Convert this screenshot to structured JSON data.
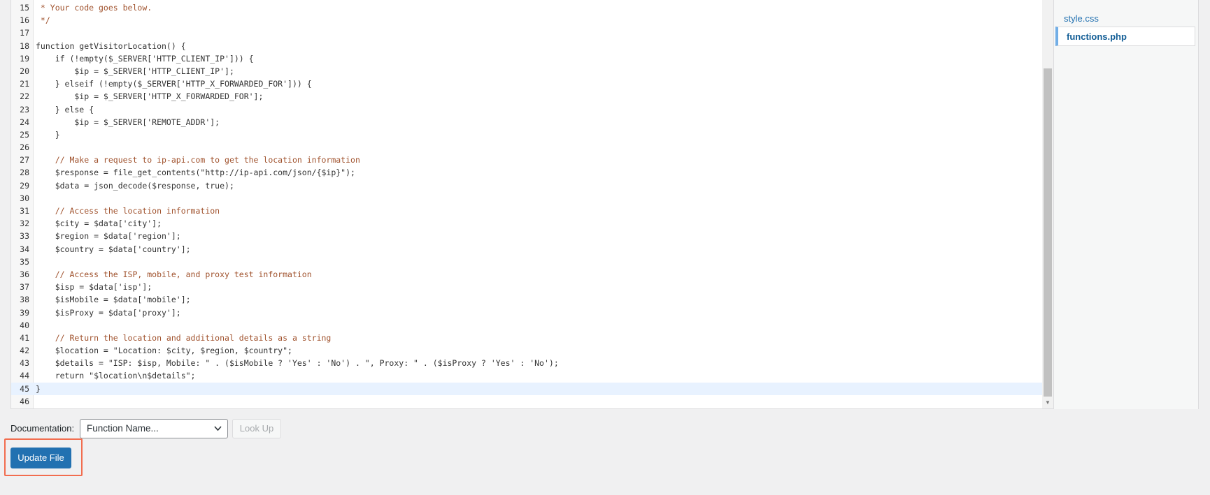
{
  "editor": {
    "lines": [
      {
        "n": "15",
        "t": " * Your code goes below.",
        "k": "com"
      },
      {
        "n": "16",
        "t": " */",
        "k": "com"
      },
      {
        "n": "17",
        "t": "",
        "k": ""
      },
      {
        "n": "18",
        "t": "function getVisitorLocation() {",
        "k": "fn"
      },
      {
        "n": "19",
        "t": "    if (!empty($_SERVER['HTTP_CLIENT_IP'])) {",
        "k": "code"
      },
      {
        "n": "20",
        "t": "        $ip = $_SERVER['HTTP_CLIENT_IP'];",
        "k": "code"
      },
      {
        "n": "21",
        "t": "    } elseif (!empty($_SERVER['HTTP_X_FORWARDED_FOR'])) {",
        "k": "code"
      },
      {
        "n": "22",
        "t": "        $ip = $_SERVER['HTTP_X_FORWARDED_FOR'];",
        "k": "code"
      },
      {
        "n": "23",
        "t": "    } else {",
        "k": "code"
      },
      {
        "n": "24",
        "t": "        $ip = $_SERVER['REMOTE_ADDR'];",
        "k": "code"
      },
      {
        "n": "25",
        "t": "    }",
        "k": "code"
      },
      {
        "n": "26",
        "t": "",
        "k": ""
      },
      {
        "n": "27",
        "t": "    // Make a request to ip-api.com to get the location information",
        "k": "com"
      },
      {
        "n": "28",
        "t": "    $response = file_get_contents(\"http://ip-api.com/json/{$ip}\");",
        "k": "code"
      },
      {
        "n": "29",
        "t": "    $data = json_decode($response, true);",
        "k": "code"
      },
      {
        "n": "30",
        "t": "",
        "k": ""
      },
      {
        "n": "31",
        "t": "    // Access the location information",
        "k": "com"
      },
      {
        "n": "32",
        "t": "    $city = $data['city'];",
        "k": "code"
      },
      {
        "n": "33",
        "t": "    $region = $data['region'];",
        "k": "code"
      },
      {
        "n": "34",
        "t": "    $country = $data['country'];",
        "k": "code"
      },
      {
        "n": "35",
        "t": "",
        "k": ""
      },
      {
        "n": "36",
        "t": "    // Access the ISP, mobile, and proxy test information",
        "k": "com"
      },
      {
        "n": "37",
        "t": "    $isp = $data['isp'];",
        "k": "code"
      },
      {
        "n": "38",
        "t": "    $isMobile = $data['mobile'];",
        "k": "code"
      },
      {
        "n": "39",
        "t": "    $isProxy = $data['proxy'];",
        "k": "code"
      },
      {
        "n": "40",
        "t": "",
        "k": ""
      },
      {
        "n": "41",
        "t": "    // Return the location and additional details as a string",
        "k": "com"
      },
      {
        "n": "42",
        "t": "    $location = \"Location: $city, $region, $country\";",
        "k": "code"
      },
      {
        "n": "43",
        "t": "    $details = \"ISP: $isp, Mobile: \" . ($isMobile ? 'Yes' : 'No') . \", Proxy: \" . ($isProxy ? 'Yes' : 'No');",
        "k": "code"
      },
      {
        "n": "44",
        "t": "    return \"$location\\n$details\";",
        "k": "code"
      },
      {
        "n": "45",
        "t": "}",
        "k": "code",
        "active": true
      },
      {
        "n": "46",
        "t": "",
        "k": ""
      }
    ]
  },
  "files": {
    "items": [
      {
        "label": "style.css",
        "active": false
      },
      {
        "label": "functions.php",
        "active": true
      }
    ]
  },
  "documentation": {
    "label": "Documentation:",
    "select_value": "Function Name...",
    "lookup_label": "Look Up"
  },
  "actions": {
    "update_label": "Update File"
  },
  "colors": {
    "accent": "#2271b1",
    "highlight": "#f26d4f"
  }
}
